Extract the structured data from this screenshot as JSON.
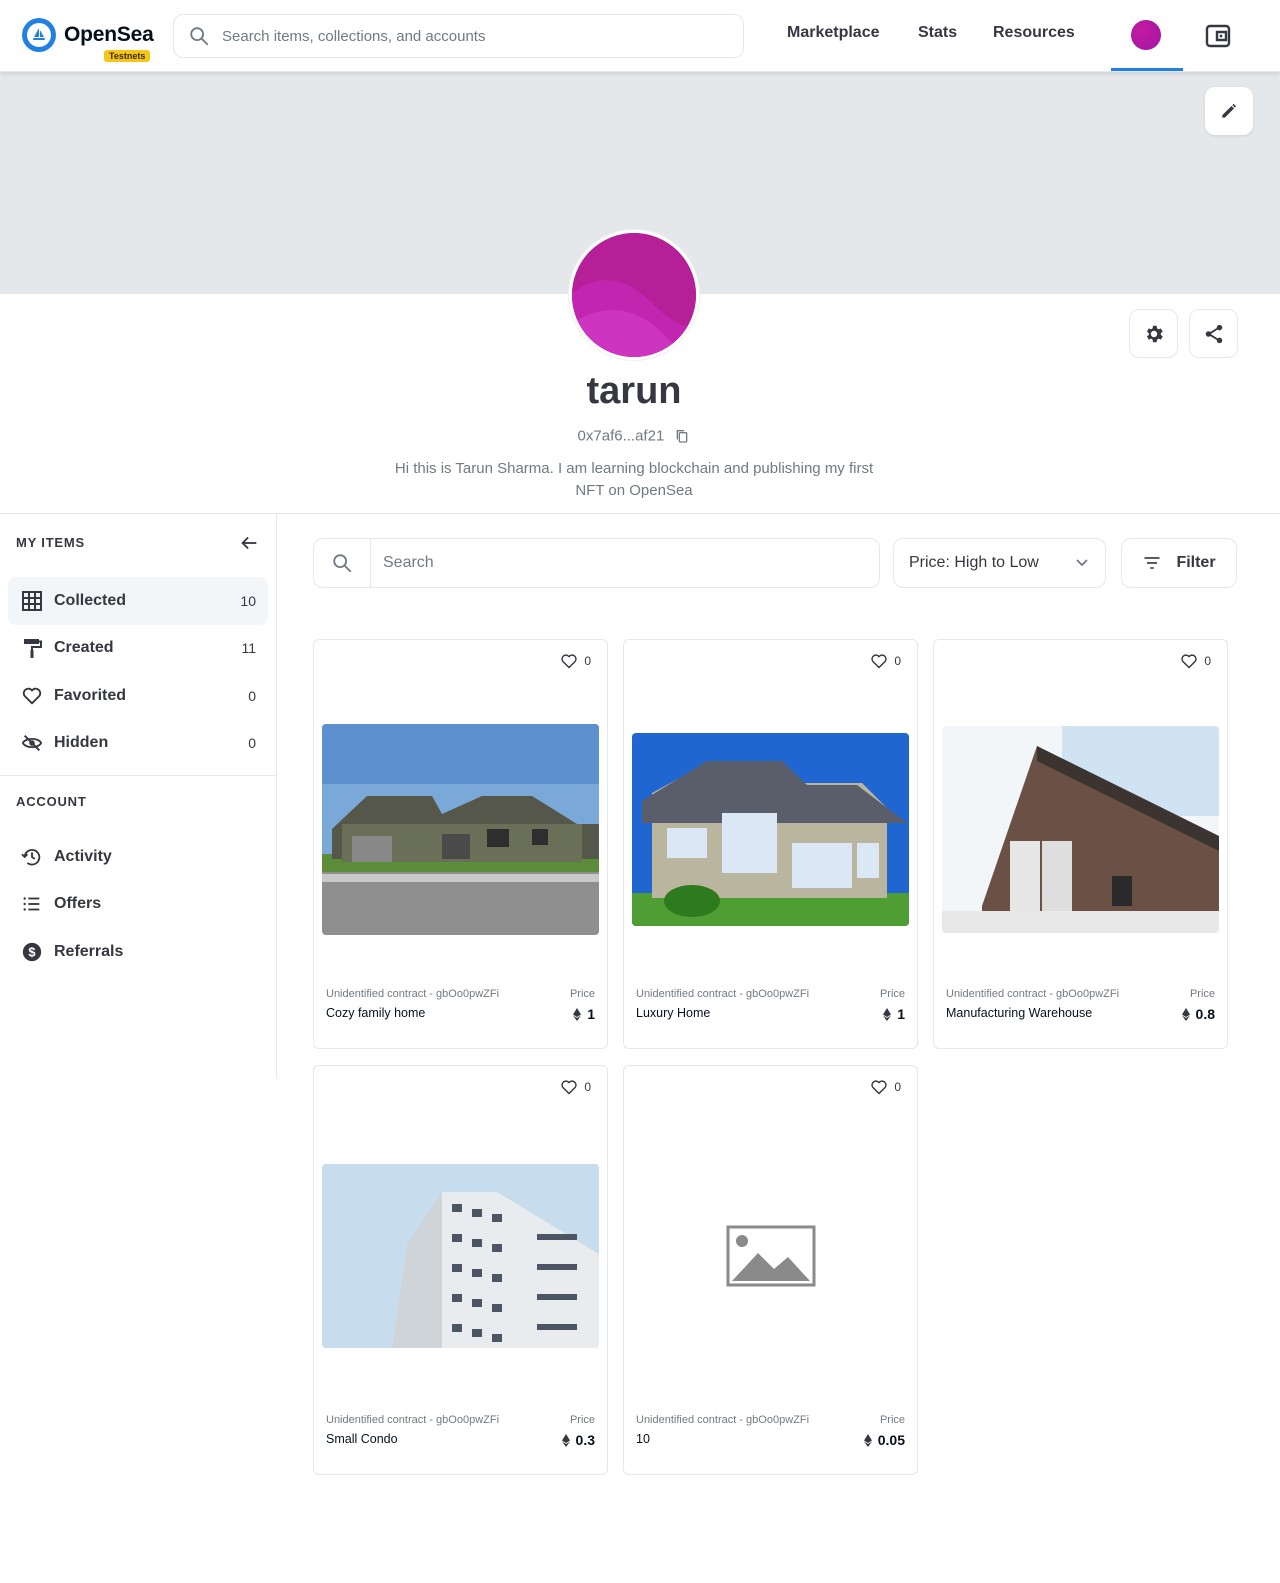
{
  "header": {
    "brand": "OpenSea",
    "badge": "Testnets",
    "search_placeholder": "Search items, collections, and accounts",
    "nav": [
      "Marketplace",
      "Stats",
      "Resources"
    ]
  },
  "profile": {
    "username": "tarun",
    "address": "0x7af6...af21",
    "bio": "Hi this is Tarun Sharma. I am learning blockchain and publishing my first NFT on OpenSea"
  },
  "sidebar": {
    "my_items_heading": "MY ITEMS",
    "items": [
      {
        "label": "Collected",
        "count": "10",
        "icon": "grid-icon"
      },
      {
        "label": "Created",
        "count": "11",
        "icon": "paint-roller-icon"
      },
      {
        "label": "Favorited",
        "count": "0",
        "icon": "heart-icon"
      },
      {
        "label": "Hidden",
        "count": "0",
        "icon": "eye-off-icon"
      }
    ],
    "account_heading": "ACCOUNT",
    "account_items": [
      {
        "label": "Activity",
        "icon": "history-icon"
      },
      {
        "label": "Offers",
        "icon": "list-icon"
      },
      {
        "label": "Referrals",
        "icon": "dollar-circle-icon"
      }
    ]
  },
  "toolbar": {
    "search_placeholder": "Search",
    "sort_value": "Price: High to Low",
    "filter_label": "Filter"
  },
  "cards": [
    {
      "favorites": "0",
      "contract": "Unidentified contract - gbOo0pwZFi",
      "name": "Cozy family home",
      "price_label": "Price",
      "price": "1"
    },
    {
      "favorites": "0",
      "contract": "Unidentified contract - gbOo0pwZFi",
      "name": "Luxury Home",
      "price_label": "Price",
      "price": "1"
    },
    {
      "favorites": "0",
      "contract": "Unidentified contract - gbOo0pwZFi",
      "name": "Manufacturing Warehouse",
      "price_label": "Price",
      "price": "0.8"
    },
    {
      "favorites": "0",
      "contract": "Unidentified contract - gbOo0pwZFi",
      "name": "Small Condo",
      "price_label": "Price",
      "price": "0.3"
    },
    {
      "favorites": "0",
      "contract": "Unidentified contract - gbOo0pwZFi",
      "name": "10",
      "price_label": "Price",
      "price": "0.05"
    }
  ],
  "colors": {
    "accent": "#2081e2",
    "avatar": "#b11d9a",
    "banner": "#e5e8eb",
    "badge": "#f5c518"
  }
}
